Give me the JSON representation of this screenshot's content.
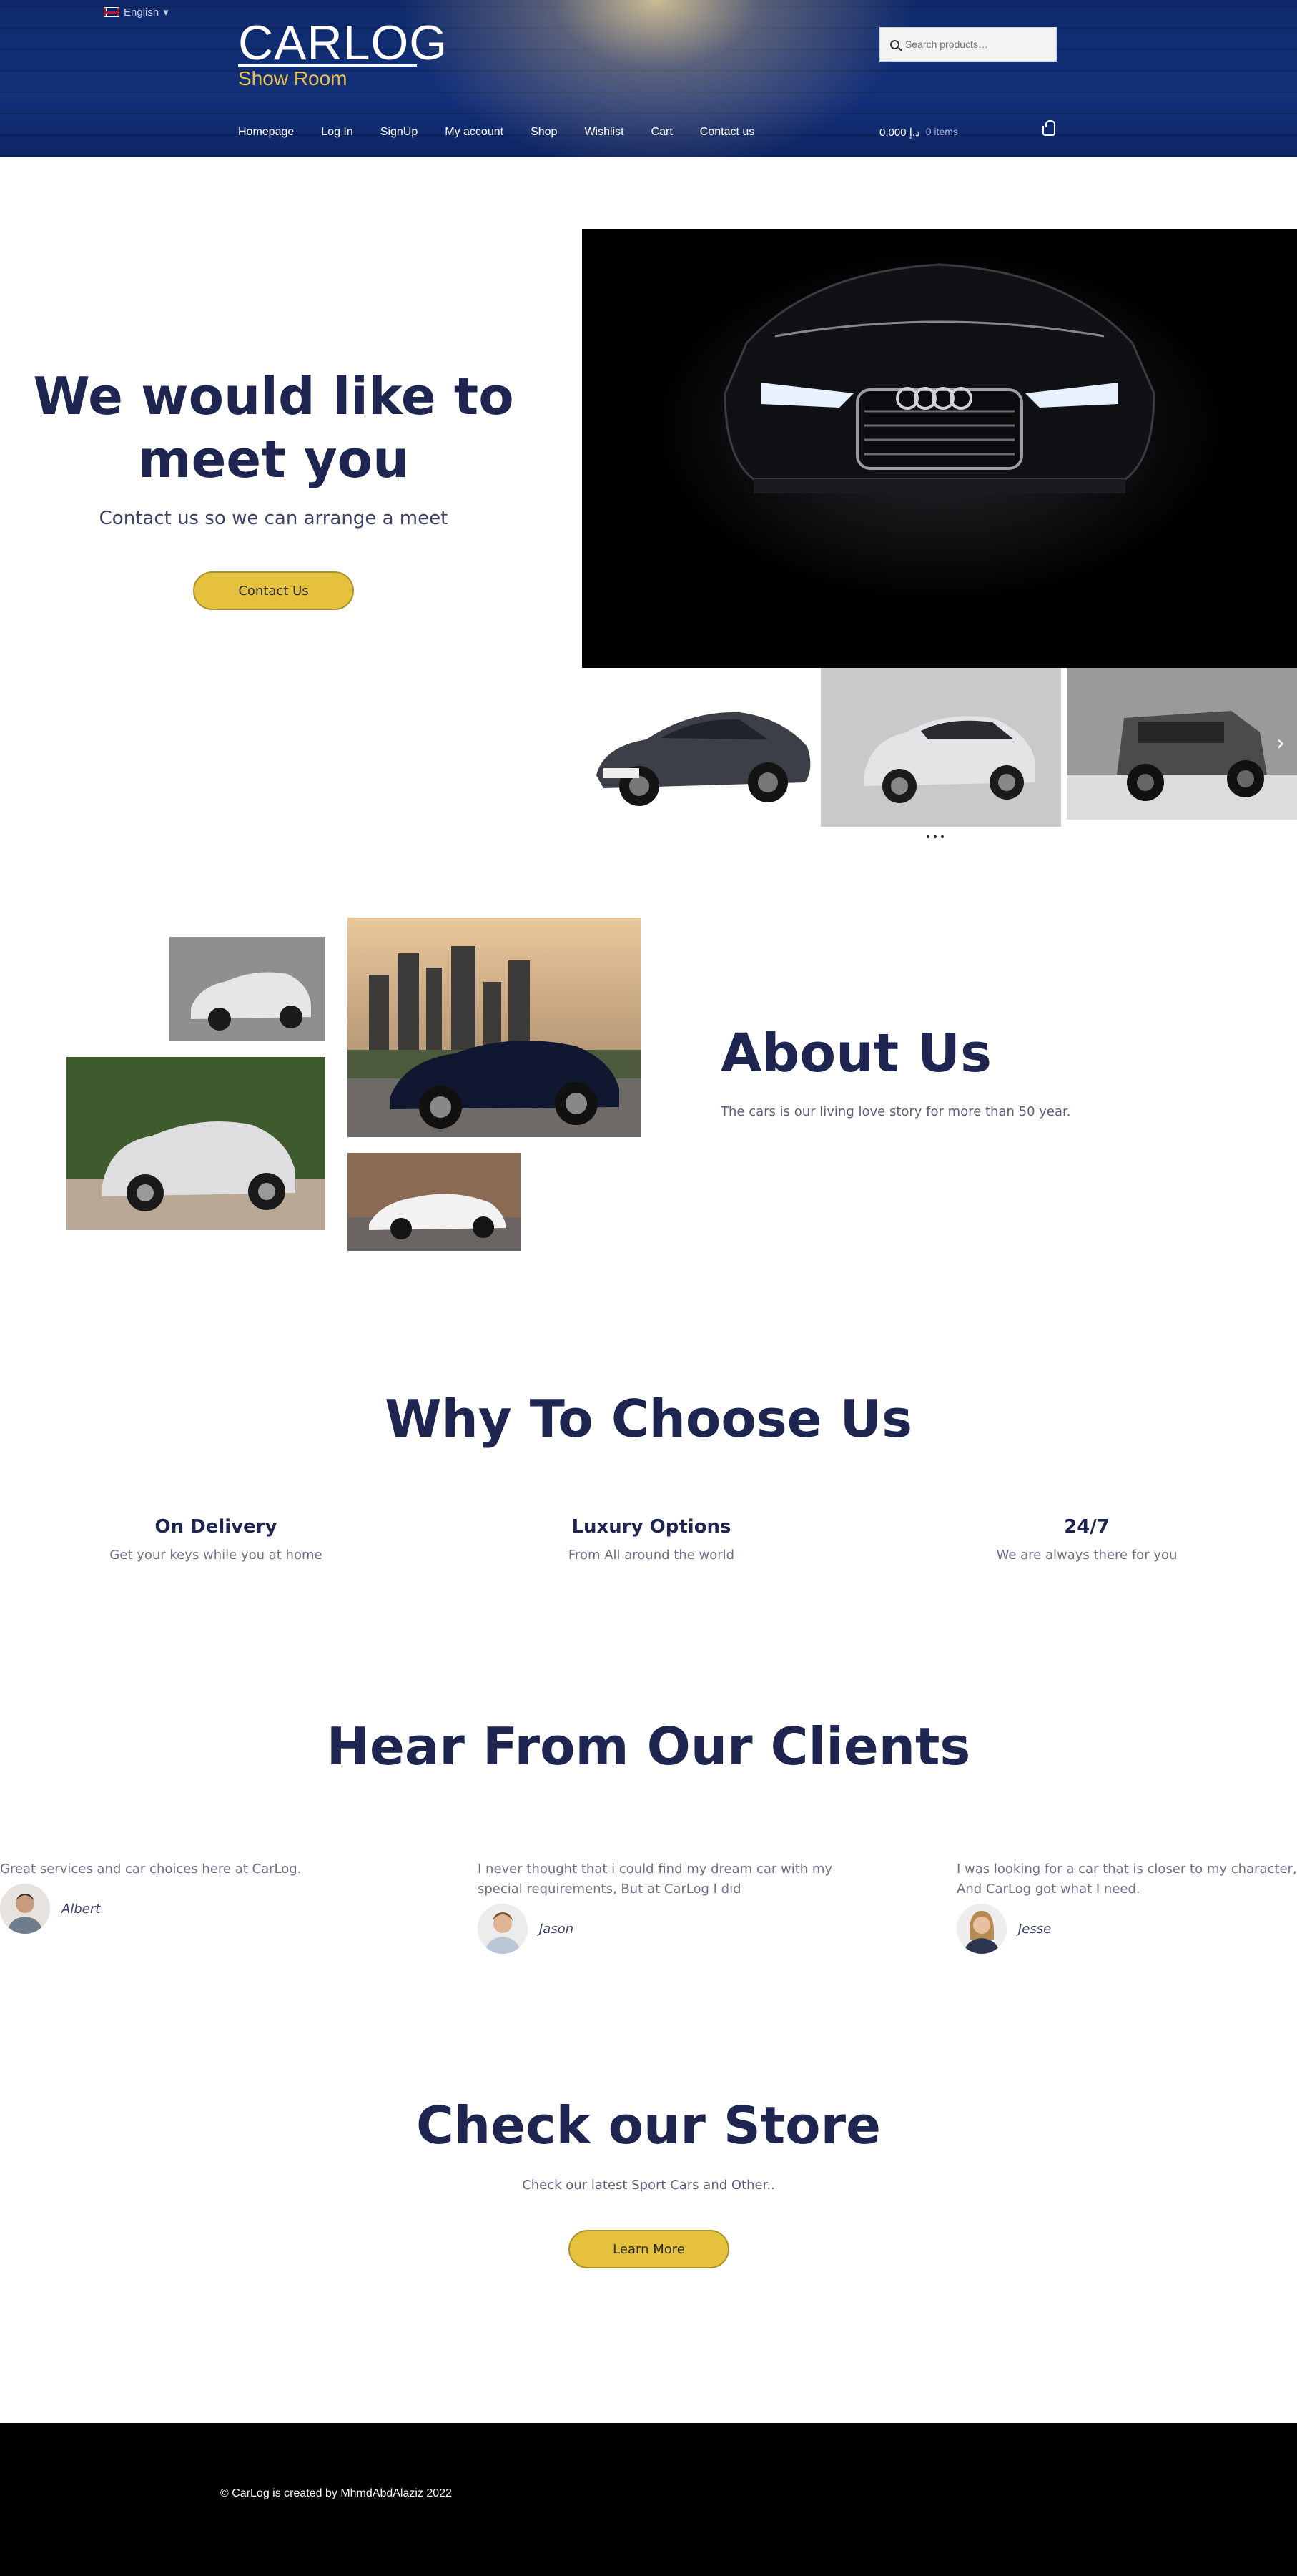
{
  "header": {
    "language": "English",
    "logo_title": "CARLOG",
    "logo_subtitle": "Show Room",
    "search_placeholder": "Search products…",
    "nav": [
      "Homepage",
      "Log In",
      "SignUp",
      "My account",
      "Shop",
      "Wishlist",
      "Cart",
      "Contact us"
    ],
    "cart_total": "0,000 د.إ",
    "cart_items": "0 items"
  },
  "hero": {
    "title_line1": "We would like to",
    "title_line2": "meet you",
    "subtitle": "Contact us so we can arrange a meet",
    "button": "Contact Us"
  },
  "about": {
    "title": "About Us",
    "text": "The cars is our living love story for more than 50 year."
  },
  "why": {
    "title": "Why To Choose Us",
    "features": [
      {
        "title": "On Delivery",
        "text": "Get your keys while you at home"
      },
      {
        "title": "Luxury Options",
        "text": "From All around the world"
      },
      {
        "title": "24/7",
        "text": "We are always there for you"
      }
    ]
  },
  "clients": {
    "title": "Hear From Our Clients",
    "testimonials": [
      {
        "text": "Great services and car choices here at CarLog.",
        "name": "Albert"
      },
      {
        "text": "I never thought that i could find my dream car with my special requirements, But at CarLog I did",
        "name": "Jason"
      },
      {
        "text": "I was looking for a car that is closer to my character, And CarLog got what I need.",
        "name": "Jesse"
      }
    ]
  },
  "store": {
    "title": "Check our Store",
    "text": "Check our latest Sport Cars and Other..",
    "button": "Learn More"
  },
  "footer": {
    "copyright": "© CarLog is created by MhmdAbdAlaziz 2022"
  },
  "colors": {
    "navy": "#1e2550",
    "accent_yellow": "#e6c13d",
    "header_blue": "#13307a",
    "footer": "#000000"
  }
}
